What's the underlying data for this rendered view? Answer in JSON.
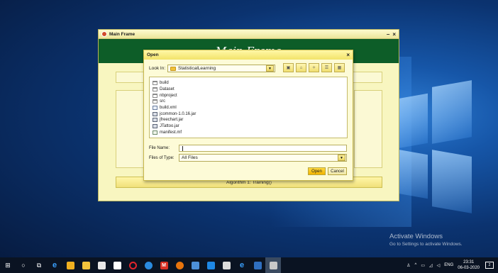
{
  "main_frame": {
    "title": "Main Frame",
    "header_text": "Main Frame",
    "minimize": "–",
    "close": "×",
    "bottom_button": "Algorithm 1: Training()"
  },
  "dialog": {
    "title": "Open",
    "close": "×",
    "look_in_label": "Look In:",
    "look_in_value": "StatisticalLearning",
    "files": [
      {
        "name": "build",
        "type": "folder"
      },
      {
        "name": "Dataset",
        "type": "folder"
      },
      {
        "name": "nbproject",
        "type": "folder"
      },
      {
        "name": "src",
        "type": "folder"
      },
      {
        "name": "build.xml",
        "type": "xml"
      },
      {
        "name": "jcommon-1.0.16.jar",
        "type": "jar"
      },
      {
        "name": "jfreechart.jar",
        "type": "jar"
      },
      {
        "name": "JTattoo.jar",
        "type": "jar"
      },
      {
        "name": "manifest.mf",
        "type": "mf"
      }
    ],
    "file_name_label": "File Name:",
    "file_name_value": "",
    "files_of_type_label": "Files of Type:",
    "files_of_type_value": "All Files",
    "open_button": "Open",
    "cancel_button": "Cancel"
  },
  "watermark": {
    "line1": "Activate Windows",
    "line2": "Go to Settings to activate Windows."
  },
  "taskbar": {
    "tray_lang": "ENG",
    "time": "23:31",
    "date": "06-03-2020",
    "notification_count": "2"
  },
  "colors": {
    "frame_header": "#0d5d28",
    "dialog_bg": "#fdfbd7",
    "open_button": "#f2b300",
    "taskbar": "#0a1322"
  }
}
